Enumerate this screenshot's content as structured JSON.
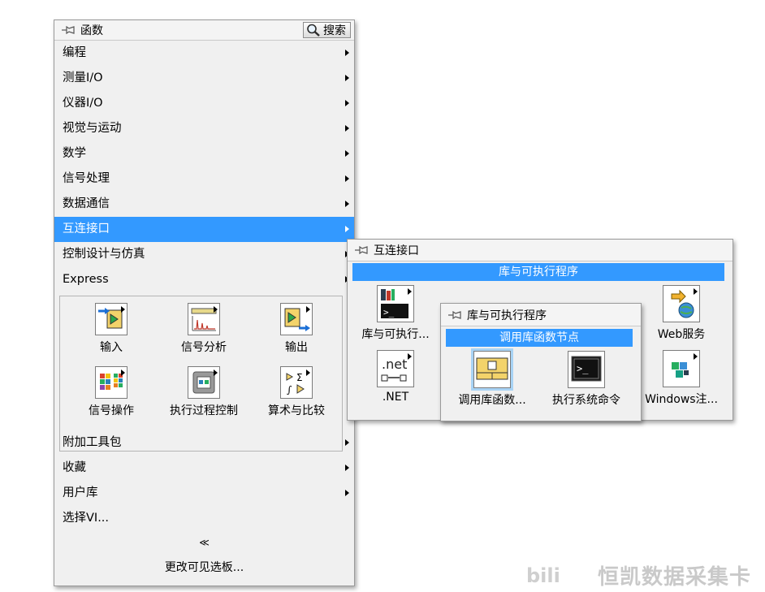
{
  "main_palette": {
    "title": "函数",
    "search_label": "搜索",
    "menu_items": [
      {
        "label": "编程"
      },
      {
        "label": "测量I/O"
      },
      {
        "label": "仪器I/O"
      },
      {
        "label": "视觉与运动"
      },
      {
        "label": "数学"
      },
      {
        "label": "信号处理"
      },
      {
        "label": "数据通信"
      },
      {
        "label": "互连接口"
      },
      {
        "label": "控制设计与仿真"
      },
      {
        "label": "Express"
      }
    ],
    "express_icons": [
      {
        "label": "输入",
        "icon": "input-icon"
      },
      {
        "label": "信号分析",
        "icon": "signal-analysis-icon"
      },
      {
        "label": "输出",
        "icon": "output-icon"
      },
      {
        "label": "信号操作",
        "icon": "signal-manipulation-icon"
      },
      {
        "label": "执行过程控制",
        "icon": "execution-control-icon"
      },
      {
        "label": "算术与比较",
        "icon": "arithmetic-comparison-icon"
      }
    ],
    "bottom_items": [
      {
        "label": "附加工具包"
      },
      {
        "label": "收藏"
      },
      {
        "label": "用户库"
      },
      {
        "label": "选择VI..."
      }
    ],
    "collapse_glyph": "≪",
    "footer_label": "更改可见选板..."
  },
  "interconnect_palette": {
    "title": "互连接口",
    "section": "库与可执行程序",
    "icons": [
      {
        "label": "库与可执行...",
        "icon": "libraries-executables-icon"
      },
      {
        "label": "Web服务",
        "icon": "web-services-icon"
      },
      {
        "label": ".NET",
        "icon": "dotnet-icon",
        "icon_text": ".net"
      },
      {
        "label": "Windows注...",
        "icon": "windows-registry-icon"
      }
    ]
  },
  "libraries_palette": {
    "title": "库与可执行程序",
    "section": "调用库函数节点",
    "icons": [
      {
        "label": "调用库函数...",
        "icon": "call-library-function-icon"
      },
      {
        "label": "执行系统命令",
        "icon": "system-exec-icon"
      }
    ]
  },
  "watermark": {
    "text": "恒凯数据采集卡"
  },
  "colors": {
    "selection": "#3399ff",
    "palette_bg": "#f0f0f0"
  }
}
